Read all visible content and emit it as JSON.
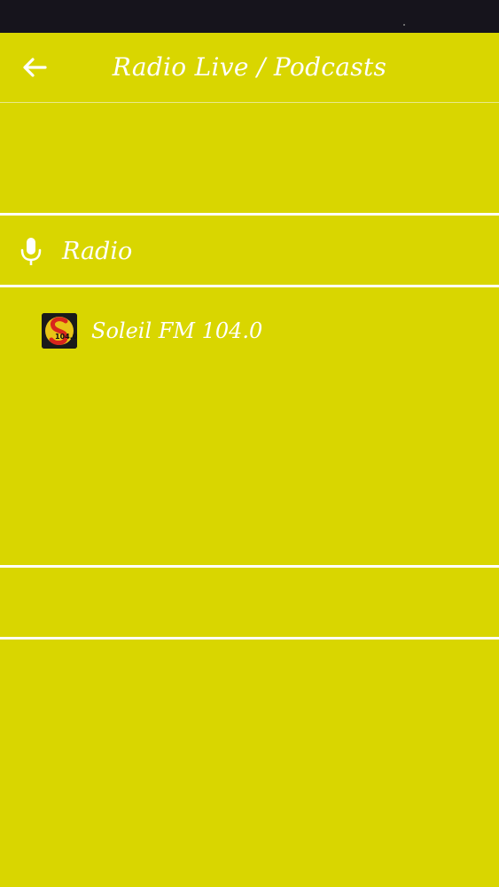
{
  "colors": {
    "background": "#d9d600",
    "text": "#ffffff",
    "status_bar": "#16141c"
  },
  "app_bar": {
    "title": "Radio Live / Podcasts",
    "back_icon": "arrow-left-icon"
  },
  "section": {
    "icon": "microphone-icon",
    "label": "Radio"
  },
  "stations": [
    {
      "name": "Soleil FM 104.0",
      "logo": {
        "icon": "soleil-fm-logo",
        "text": "104.0"
      }
    }
  ]
}
